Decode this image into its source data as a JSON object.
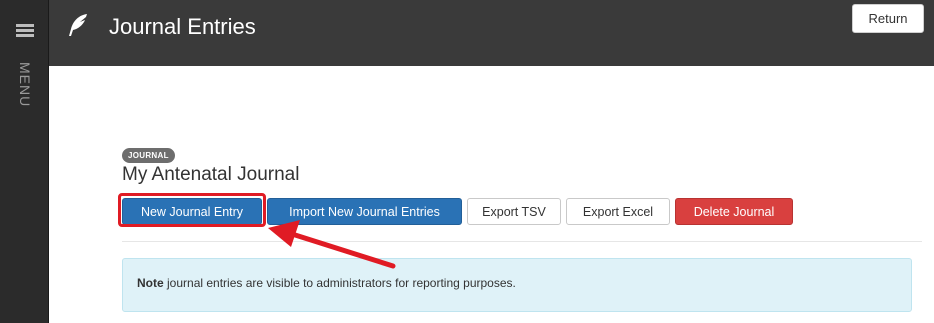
{
  "sidebar": {
    "menu_icon": "hamburger-icon",
    "menu_label": "MENU"
  },
  "header": {
    "logo_icon": "feather-icon",
    "title": "Journal Entries",
    "return_label": "Return"
  },
  "journal": {
    "badge": "JOURNAL",
    "name": "My Antenatal Journal"
  },
  "actions": {
    "new_entry": "New Journal Entry",
    "import_entries": "Import New Journal Entries",
    "export_tsv": "Export TSV",
    "export_excel": "Export Excel",
    "delete_journal": "Delete Journal"
  },
  "note": {
    "bold": "Note",
    "text": " journal entries are visible to administrators for reporting purposes."
  },
  "colors": {
    "sidebar_bg": "#2b2b2b",
    "topbar_bg": "#3a3a3a",
    "primary": "#2a72b5",
    "danger": "#d9403f",
    "note_bg": "#dff2f8",
    "annotation": "#e01b24"
  }
}
